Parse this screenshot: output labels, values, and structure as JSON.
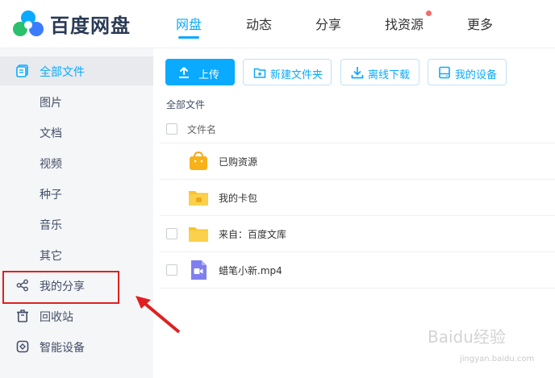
{
  "app": {
    "brand": "百度网盘",
    "colors": {
      "accent": "#09aaff",
      "annotation": "#e02020",
      "notification": "#f56c6c"
    }
  },
  "nav": {
    "items": [
      "网盘",
      "动态",
      "分享",
      "找资源",
      "更多"
    ],
    "active": "网盘"
  },
  "sidebar": {
    "items": [
      {
        "label": "全部文件",
        "icon": "files-icon",
        "active": true
      },
      {
        "label": "图片"
      },
      {
        "label": "文档"
      },
      {
        "label": "视频"
      },
      {
        "label": "种子"
      },
      {
        "label": "音乐"
      },
      {
        "label": "其它"
      },
      {
        "label": "我的分享",
        "icon": "share-icon",
        "highlighted": true
      },
      {
        "label": "回收站",
        "icon": "trash-icon"
      },
      {
        "label": "智能设备",
        "icon": "device-icon"
      }
    ]
  },
  "toolbar": {
    "upload": "上传",
    "new_folder": "新建文件夹",
    "offline_download": "离线下载",
    "my_devices": "我的设备"
  },
  "breadcrumb": "全部文件",
  "file_list": {
    "column_header": "文件名",
    "rows": [
      {
        "name": "已购资源",
        "icon": "purchase-bag-icon",
        "has_checkbox": false
      },
      {
        "name": "我的卡包",
        "icon": "card-folder-icon",
        "has_checkbox": false
      },
      {
        "name": "来自：百度文库",
        "icon": "folder-icon",
        "has_checkbox": true
      },
      {
        "name": "蜡笔小新.mp4",
        "icon": "video-file-icon",
        "has_checkbox": true
      }
    ]
  },
  "watermark": {
    "text": "Baidu经验",
    "sub": "jingyan.baidu.com"
  }
}
